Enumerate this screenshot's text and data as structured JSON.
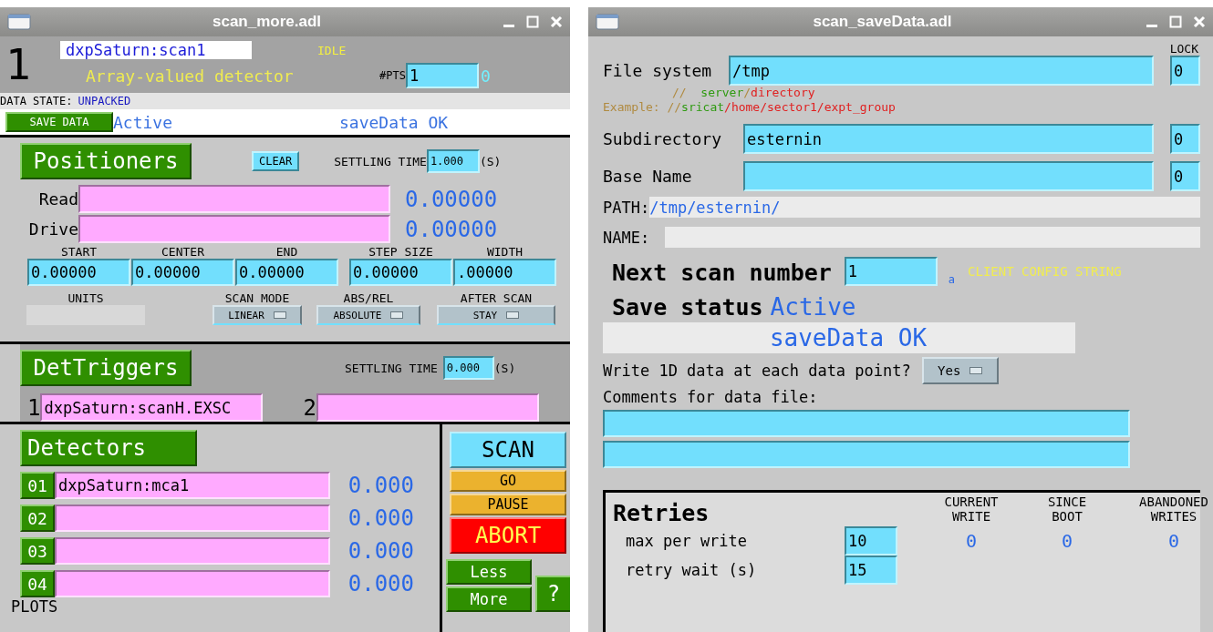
{
  "scan_more": {
    "title": "scan_more.adl",
    "scan_index": "1",
    "pv": "dxpSaturn:scan1",
    "state": "IDLE",
    "description": "Array-valued detector",
    "pts_label": "#PTS",
    "pts_value": "1",
    "pts_indicator": "0",
    "data_state_label": "DATA STATE:",
    "data_state": "UNPACKED",
    "save_button": "SAVE DATA",
    "save_status": "Active",
    "save_message": "saveData OK",
    "positioners": {
      "button": "Positioners",
      "clear": "CLEAR",
      "settling_label": "SETTLING TIME",
      "settling_value": "1.000",
      "settling_unit": "(S)",
      "rows": [
        {
          "label": "Read",
          "value": "0.00000"
        },
        {
          "label": "Drive",
          "value": "0.00000"
        }
      ],
      "params": [
        {
          "label": "START",
          "value": "0.00000"
        },
        {
          "label": "CENTER",
          "value": "0.00000"
        },
        {
          "label": "END",
          "value": "0.00000"
        },
        {
          "label": "STEP SIZE",
          "value": "0.00000"
        },
        {
          "label": "WIDTH",
          "value": ".00000"
        }
      ],
      "units_label": "UNITS",
      "menus": [
        {
          "label": "SCAN MODE",
          "value": "LINEAR"
        },
        {
          "label": "ABS/REL",
          "value": "ABSOLUTE"
        },
        {
          "label": "AFTER SCAN",
          "value": "STAY"
        }
      ]
    },
    "det_triggers": {
      "button": "DetTriggers",
      "settling_label": "SETTLING TIME",
      "settling_value": "0.000",
      "settling_unit": "(S)",
      "triggers": [
        {
          "index": "1",
          "value": "dxpSaturn:scanH.EXSC"
        },
        {
          "index": "2"
        }
      ]
    },
    "detectors": {
      "button": "Detectors",
      "rows": [
        {
          "index": "01",
          "pv": "dxpSaturn:mca1",
          "value": "0.000"
        },
        {
          "index": "02",
          "value": "0.000"
        },
        {
          "index": "03",
          "value": "0.000"
        },
        {
          "index": "04",
          "value": "0.000"
        }
      ],
      "plots_label": "PLOTS"
    },
    "controls": {
      "scan": "SCAN",
      "go": "GO",
      "pause": "PAUSE",
      "abort": "ABORT",
      "less": "Less",
      "more": "More",
      "help": "?"
    }
  },
  "scan_save_data": {
    "title": "scan_saveData.adl",
    "lock_label": "LOCK",
    "fields": [
      {
        "label": "File system",
        "value": "/tmp",
        "lock": "0"
      },
      {
        "label": "Subdirectory",
        "value": "esternin",
        "lock": "0"
      },
      {
        "label": "Base Name",
        "lock": "0"
      }
    ],
    "hints": [
      [
        {
          "text": "//  ",
          "color": "#b08a40"
        },
        {
          "text": "server",
          "color": "#2e9a10"
        },
        {
          "text": "/",
          "color": "#b08a40"
        },
        {
          "text": "directory",
          "color": "#e02020"
        }
      ],
      [
        {
          "text": "Example: //",
          "color": "#b08a40"
        },
        {
          "text": "sricat",
          "color": "#2e9a10"
        },
        {
          "text": "/home/sector1/expt_group",
          "color": "#e02020"
        }
      ]
    ],
    "path": {
      "label": "PATH:",
      "value": "/tmp/esternin/"
    },
    "name": {
      "label": "NAME:"
    },
    "next_scan": {
      "label": "Next scan number",
      "value": "1",
      "marker": "a"
    },
    "client_config": "CLIENT CONFIG STRING",
    "save_status": {
      "label": "Save status",
      "value": "Active"
    },
    "message": "saveData OK",
    "write_1d": {
      "label": "Write 1D data at each data point?",
      "value": "Yes"
    },
    "comments_label": "Comments for data file:",
    "retries": {
      "title": "Retries",
      "columns": [
        [
          "CURRENT",
          "WRITE"
        ],
        [
          "SINCE",
          "BOOT"
        ],
        [
          "ABANDONED",
          "WRITES"
        ]
      ],
      "rows": [
        {
          "label": "max per write",
          "value": "10",
          "counts": [
            "0",
            "0",
            "0"
          ]
        },
        {
          "label": "retry wait (s)",
          "value": "15"
        }
      ]
    }
  }
}
